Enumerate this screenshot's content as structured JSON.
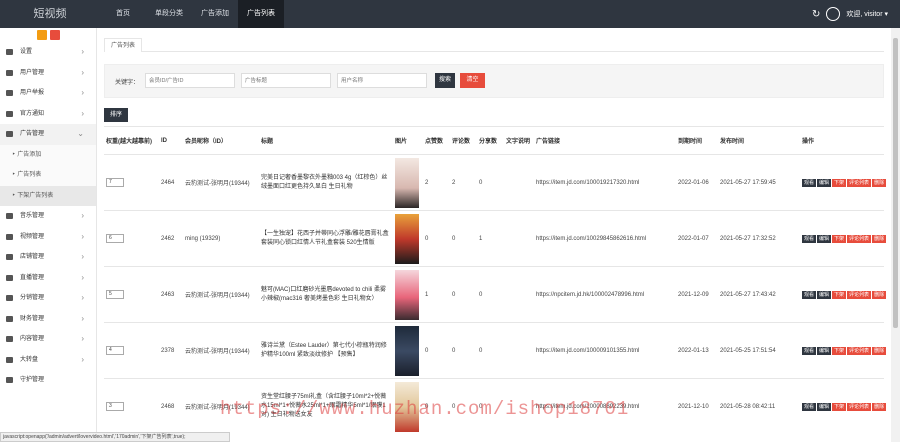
{
  "app": {
    "logo": "短视频"
  },
  "nav": [
    {
      "label": "首页"
    },
    {
      "label": "单段分类"
    },
    {
      "label": "广告添加"
    },
    {
      "label": "广告列表"
    }
  ],
  "topright": {
    "user": "欢迎, visitor ▾"
  },
  "sidebar": {
    "items": [
      {
        "label": "设置"
      },
      {
        "label": "用户管理"
      },
      {
        "label": "用户举报"
      },
      {
        "label": "官方通知"
      },
      {
        "label": "广告管理"
      },
      {
        "label": "音乐管理"
      },
      {
        "label": "视频管理"
      },
      {
        "label": "店铺管理"
      },
      {
        "label": "直播管理"
      },
      {
        "label": "分销管理"
      },
      {
        "label": "财务管理"
      },
      {
        "label": "内容管理"
      },
      {
        "label": "大转盘"
      },
      {
        "label": "守护管理"
      }
    ],
    "subitems": [
      {
        "label": "‣ 广告添加"
      },
      {
        "label": "‣ 广告列表"
      },
      {
        "label": "‣ 下架广告列表"
      }
    ]
  },
  "tab": {
    "label": "广告列表"
  },
  "search": {
    "keyword_label": "关键字：",
    "ph1": "会员ID/广告ID",
    "ph2": "广告标题",
    "ph3": "用户名称",
    "search_btn": "搜索",
    "clear_btn": "清空"
  },
  "sort_btn": "排序",
  "table": {
    "headers": [
      "权重(越大越靠前)",
      "ID",
      "会员昵称（ID）",
      "标题",
      "图片",
      "点赞数",
      "评论数",
      "分享数",
      "文字说明",
      "广告链接",
      "到期时间",
      "发布时间",
      "操作"
    ],
    "rows": [
      {
        "sort": "7",
        "id": "2464",
        "user": "云豹测试-张明月(19344)",
        "title": "完美日记奢香墨黎衣外墨釉003 4g（红棕色）丝绒墨面口红更色持久显白 生日礼物",
        "likes": "2",
        "comments": "2",
        "shares": "0",
        "desc": "",
        "link": "https://item.jd.com/100019217320.html",
        "expire": "2022-01-06",
        "publish": "2021-05-27 17:59:45"
      },
      {
        "sort": "6",
        "id": "2462",
        "user": "ming (19329)",
        "title": "【一生独宠】花西子并蒂同心浮雕/雕花唇膏礼盒套装同心锁口红情人节礼盒套装 520生情版",
        "likes": "0",
        "comments": "0",
        "shares": "1",
        "desc": "",
        "link": "https://item.jd.com/10029845862616.html",
        "expire": "2022-01-07",
        "publish": "2021-05-27 17:32:52"
      },
      {
        "sort": "5",
        "id": "2463",
        "user": "云豹测试-张明月(19344)",
        "title": "魅可(MAC)口红磨砂光墨唇devoted to chili 柔雾小辣椒(mac316 奢美烤墨色彩 生日礼物女）",
        "likes": "1",
        "comments": "0",
        "shares": "0",
        "desc": "",
        "link": "https://npcitem.jd.hk/100002478996.html",
        "expire": "2021-12-09",
        "publish": "2021-05-27 17:43:42"
      },
      {
        "sort": "4",
        "id": "2378",
        "user": "云豹测试-张明月(19344)",
        "title": "雅诗兰黛（Estee Lauder）第七代小棕瓶特润修护精华100ml 紧致淡纹修护 【预售】",
        "likes": "0",
        "comments": "0",
        "shares": "0",
        "desc": "",
        "link": "https://item.jd.com/100009101355.html",
        "expire": "2022-01-13",
        "publish": "2021-05-25 17:51:54"
      },
      {
        "sort": "3",
        "id": "2468",
        "user": "云豹测试-张明月(19344)",
        "title": "资生堂红腰子75ml礼盒（含红腰子10ml*2+悦薇水15ml*1+悦薇水25ml*1+眼霜精华5ml*1/眼膜1对) 生日礼物送女友",
        "likes": "0",
        "comments": "0",
        "shares": "0",
        "desc": "",
        "link": "https://item.jd.com/100008892239.html",
        "expire": "2021-12-10",
        "publish": "2021-05-28 08:42:11"
      }
    ],
    "ops": {
      "view": "观看",
      "edit": "编辑",
      "off": "下架",
      "comments": "评论列表",
      "delete": "删除"
    }
  },
  "statusbar": "javascript:openapp('/admin/advert/lovervideo.html','170admin','下架广告列表',true);",
  "watermark": "https://www.huzhan.com/ishop18701",
  "colors": {
    "dark": "#2f3640",
    "danger": "#e74c3c"
  }
}
